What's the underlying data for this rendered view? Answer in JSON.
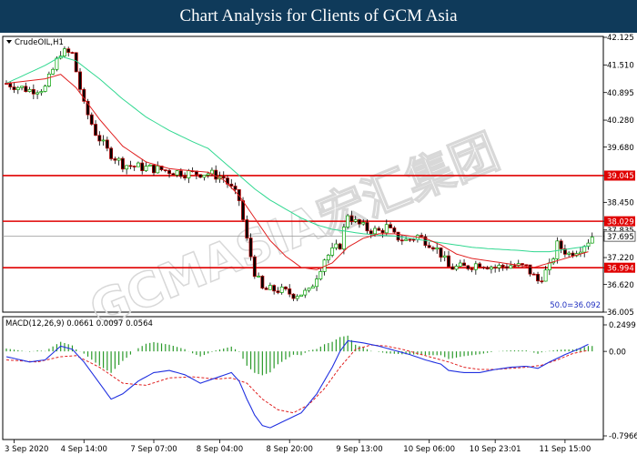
{
  "header": {
    "title": "Chart Analysis for Clients of GCM Asia"
  },
  "watermark": "GCMASIA宏汇集团",
  "colors": {
    "header_bg": "#0f3a5a",
    "bull_candle": "#00a000",
    "bear_candle": "#c00000",
    "ma_fast": "#e02020",
    "ma_slow": "#30d890",
    "level_line": "#e00000",
    "macd_line": "#2030e0",
    "signal_line": "#e02020",
    "histogram": "#2a9a2a"
  },
  "chart_data": [
    {
      "type": "candlestick",
      "symbol_label": "CrudeOIL,H1",
      "ylim": [
        36.005,
        42.125
      ],
      "yticks": [
        "42.125",
        "41.510",
        "40.895",
        "40.280",
        "39.680",
        "39.045",
        "38.450",
        "38.029",
        "37.835",
        "37.695",
        "37.220",
        "36.994",
        "36.620",
        "36.005"
      ],
      "xticks": [
        "3 Sep 2020",
        "4 Sep 14:00",
        "7 Sep 07:00",
        "8 Sep 04:00",
        "8 Sep 20:00",
        "9 Sep 13:00",
        "10 Sep 06:00",
        "10 Sep 23:01",
        "11 Sep 15:00"
      ],
      "current_price": 37.695,
      "levels": [
        {
          "value": 39.045,
          "label": "39.045"
        },
        {
          "value": 38.029,
          "label": "38.029"
        },
        {
          "value": 36.994,
          "label": "36.994"
        }
      ],
      "fib_label": "50.0=36.092",
      "close_path": [
        [
          0,
          41.1
        ],
        [
          6,
          40.95
        ],
        [
          10,
          41.0
        ],
        [
          14,
          41.8
        ],
        [
          17,
          41.75
        ],
        [
          20,
          40.6
        ],
        [
          23,
          40.0
        ],
        [
          26,
          39.6
        ],
        [
          30,
          39.3
        ],
        [
          33,
          39.25
        ],
        [
          38,
          39.2
        ],
        [
          42,
          39.15
        ],
        [
          46,
          39.1
        ],
        [
          52,
          39.1
        ],
        [
          56,
          39.0
        ],
        [
          60,
          38.5
        ],
        [
          62,
          37.6
        ],
        [
          64,
          36.9
        ],
        [
          66,
          36.5
        ],
        [
          70,
          36.5
        ],
        [
          74,
          36.4
        ],
        [
          78,
          36.45
        ],
        [
          82,
          37.2
        ],
        [
          86,
          37.5
        ],
        [
          88,
          38.2
        ],
        [
          90,
          38.0
        ],
        [
          93,
          37.85
        ],
        [
          96,
          37.8
        ],
        [
          98,
          37.9
        ],
        [
          100,
          37.7
        ],
        [
          103,
          37.6
        ],
        [
          106,
          37.7
        ],
        [
          110,
          37.5
        ],
        [
          112,
          37.3
        ],
        [
          114,
          37.0
        ],
        [
          118,
          37.0
        ],
        [
          122,
          37.1
        ],
        [
          126,
          37.0
        ],
        [
          130,
          37.05
        ],
        [
          134,
          37.0
        ],
        [
          137,
          36.7
        ],
        [
          140,
          37.0
        ],
        [
          142,
          37.5
        ],
        [
          145,
          37.3
        ],
        [
          148,
          37.45
        ],
        [
          150,
          37.6
        ],
        [
          151,
          37.7
        ]
      ],
      "ma_fast": [
        [
          0,
          41.1
        ],
        [
          10,
          41.2
        ],
        [
          14,
          41.3
        ],
        [
          18,
          41.0
        ],
        [
          24,
          40.3
        ],
        [
          30,
          39.7
        ],
        [
          36,
          39.35
        ],
        [
          42,
          39.2
        ],
        [
          48,
          39.15
        ],
        [
          52,
          39.12
        ],
        [
          56,
          38.95
        ],
        [
          60,
          38.6
        ],
        [
          64,
          38.1
        ],
        [
          68,
          37.6
        ],
        [
          72,
          37.25
        ],
        [
          76,
          37.0
        ],
        [
          80,
          36.95
        ],
        [
          84,
          37.1
        ],
        [
          88,
          37.45
        ],
        [
          92,
          37.65
        ],
        [
          96,
          37.75
        ],
        [
          100,
          37.75
        ],
        [
          104,
          37.7
        ],
        [
          108,
          37.65
        ],
        [
          112,
          37.5
        ],
        [
          116,
          37.3
        ],
        [
          120,
          37.2
        ],
        [
          124,
          37.15
        ],
        [
          128,
          37.1
        ],
        [
          132,
          37.05
        ],
        [
          136,
          37.0
        ],
        [
          140,
          37.1
        ],
        [
          144,
          37.2
        ],
        [
          148,
          37.3
        ],
        [
          150,
          37.35
        ]
      ],
      "ma_slow": [
        [
          0,
          41.1
        ],
        [
          10,
          41.5
        ],
        [
          14,
          41.7
        ],
        [
          18,
          41.6
        ],
        [
          24,
          41.2
        ],
        [
          30,
          40.75
        ],
        [
          36,
          40.35
        ],
        [
          42,
          40.05
        ],
        [
          48,
          39.8
        ],
        [
          52,
          39.65
        ],
        [
          56,
          39.35
        ],
        [
          60,
          39.05
        ],
        [
          64,
          38.75
        ],
        [
          68,
          38.5
        ],
        [
          72,
          38.3
        ],
        [
          76,
          38.1
        ],
        [
          80,
          37.95
        ],
        [
          84,
          37.85
        ],
        [
          88,
          37.8
        ],
        [
          92,
          37.75
        ],
        [
          96,
          37.72
        ],
        [
          100,
          37.7
        ],
        [
          104,
          37.65
        ],
        [
          108,
          37.6
        ],
        [
          112,
          37.55
        ],
        [
          116,
          37.5
        ],
        [
          120,
          37.45
        ],
        [
          124,
          37.42
        ],
        [
          128,
          37.4
        ],
        [
          132,
          37.38
        ],
        [
          136,
          37.35
        ],
        [
          140,
          37.35
        ],
        [
          144,
          37.4
        ],
        [
          148,
          37.45
        ],
        [
          150,
          37.48
        ]
      ]
    },
    {
      "type": "line",
      "indicator_label": "MACD(12,26,9) 0.0661 0.0097 0.0564",
      "ylim": [
        -0.7966,
        0.2499
      ],
      "yticks": [
        "0.2499",
        "0.00",
        "-0.7966"
      ],
      "series": [
        {
          "name": "MACD",
          "values": [
            [
              0,
              -0.05
            ],
            [
              6,
              -0.1
            ],
            [
              10,
              -0.08
            ],
            [
              14,
              0.05
            ],
            [
              17,
              0.02
            ],
            [
              20,
              -0.1
            ],
            [
              24,
              -0.3
            ],
            [
              27,
              -0.45
            ],
            [
              30,
              -0.4
            ],
            [
              34,
              -0.28
            ],
            [
              38,
              -0.2
            ],
            [
              42,
              -0.18
            ],
            [
              46,
              -0.22
            ],
            [
              50,
              -0.3
            ],
            [
              54,
              -0.25
            ],
            [
              58,
              -0.2
            ],
            [
              60,
              -0.28
            ],
            [
              62,
              -0.45
            ],
            [
              64,
              -0.6
            ],
            [
              66,
              -0.7
            ],
            [
              68,
              -0.72
            ],
            [
              72,
              -0.65
            ],
            [
              76,
              -0.58
            ],
            [
              80,
              -0.4
            ],
            [
              84,
              -0.15
            ],
            [
              86,
              0.0
            ],
            [
              88,
              0.1
            ],
            [
              92,
              0.08
            ],
            [
              96,
              0.05
            ],
            [
              100,
              0.01
            ],
            [
              104,
              -0.03
            ],
            [
              108,
              -0.08
            ],
            [
              112,
              -0.12
            ],
            [
              114,
              -0.18
            ],
            [
              118,
              -0.2
            ],
            [
              122,
              -0.2
            ],
            [
              126,
              -0.17
            ],
            [
              130,
              -0.15
            ],
            [
              134,
              -0.14
            ],
            [
              137,
              -0.16
            ],
            [
              140,
              -0.1
            ],
            [
              144,
              -0.03
            ],
            [
              148,
              0.03
            ],
            [
              150,
              0.0661
            ]
          ]
        },
        {
          "name": "Signal",
          "values": [
            [
              0,
              -0.08
            ],
            [
              8,
              -0.1
            ],
            [
              14,
              -0.05
            ],
            [
              18,
              -0.04
            ],
            [
              24,
              -0.15
            ],
            [
              30,
              -0.3
            ],
            [
              36,
              -0.32
            ],
            [
              42,
              -0.25
            ],
            [
              48,
              -0.24
            ],
            [
              54,
              -0.26
            ],
            [
              58,
              -0.25
            ],
            [
              62,
              -0.3
            ],
            [
              66,
              -0.45
            ],
            [
              70,
              -0.55
            ],
            [
              74,
              -0.58
            ],
            [
              78,
              -0.5
            ],
            [
              82,
              -0.35
            ],
            [
              86,
              -0.15
            ],
            [
              90,
              0.02
            ],
            [
              94,
              0.06
            ],
            [
              98,
              0.05
            ],
            [
              102,
              0.02
            ],
            [
              106,
              -0.02
            ],
            [
              110,
              -0.06
            ],
            [
              114,
              -0.1
            ],
            [
              118,
              -0.15
            ],
            [
              122,
              -0.17
            ],
            [
              126,
              -0.17
            ],
            [
              130,
              -0.16
            ],
            [
              134,
              -0.15
            ],
            [
              138,
              -0.13
            ],
            [
              142,
              -0.08
            ],
            [
              146,
              -0.02
            ],
            [
              150,
              0.0097
            ]
          ]
        }
      ]
    }
  ]
}
